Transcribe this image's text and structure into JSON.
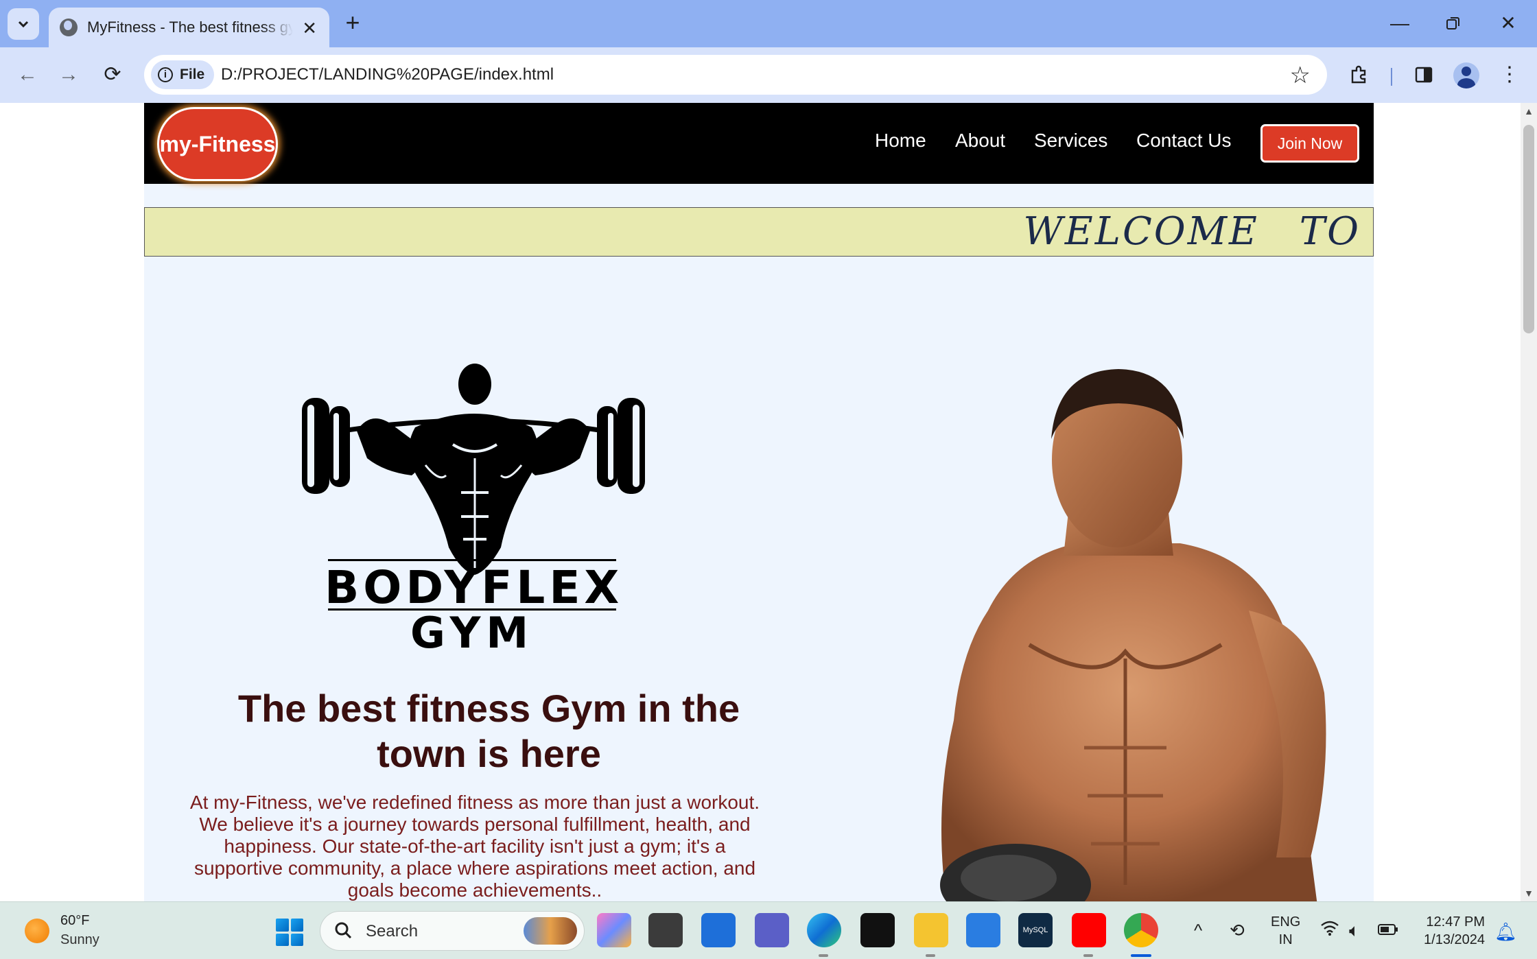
{
  "browser": {
    "tab_title": "MyFitness - The best fitness gym",
    "new_tab_symbol": "+",
    "close_symbol": "✕",
    "address_chip_label": "File",
    "url": "D:/PROJECT/LANDING%20PAGE/index.html"
  },
  "site": {
    "logo_text": "my-Fitness",
    "menu": [
      "Home",
      "About",
      "Services",
      "Contact Us"
    ],
    "join_label": "Join Now",
    "marquee_text": "WELCOME TO",
    "brand_line1": "BODYFLEX",
    "brand_line2": "GYM",
    "headline": "The best fitness Gym in the town is here",
    "lead": "At my-Fitness, we've redefined fitness as more than just a workout. We believe it's a journey towards personal fulfillment, health, and happiness. Our state-of-the-art facility isn't just a gym; it's a supportive community, a place where aspirations meet action, and goals become achievements..",
    "colors": {
      "nav_bg": "#000000",
      "accent": "#dc3b26",
      "marquee_bg": "#e8eab0",
      "page_bg": "#eef5fe",
      "headline": "#3a0f0f",
      "lead": "#7a1d1d"
    }
  },
  "taskbar": {
    "weather_temp": "60°F",
    "weather_condition": "Sunny",
    "search_placeholder": "Search",
    "lang_line1": "ENG",
    "lang_line2": "IN",
    "time": "12:47 PM",
    "date": "1/13/2024",
    "mysql_label": "MySQL"
  },
  "icons": [
    "tab-search-icon",
    "globe-icon",
    "back-icon",
    "forward-icon",
    "reload-icon",
    "info-icon",
    "star-icon",
    "extensions-icon",
    "side-panel-icon",
    "profile-icon",
    "menu-icon",
    "minimize-icon",
    "restore-icon",
    "close-icon",
    "windows-start-icon",
    "search-icon",
    "wifi-icon",
    "volume-icon",
    "battery-icon",
    "notification-bell-icon"
  ]
}
